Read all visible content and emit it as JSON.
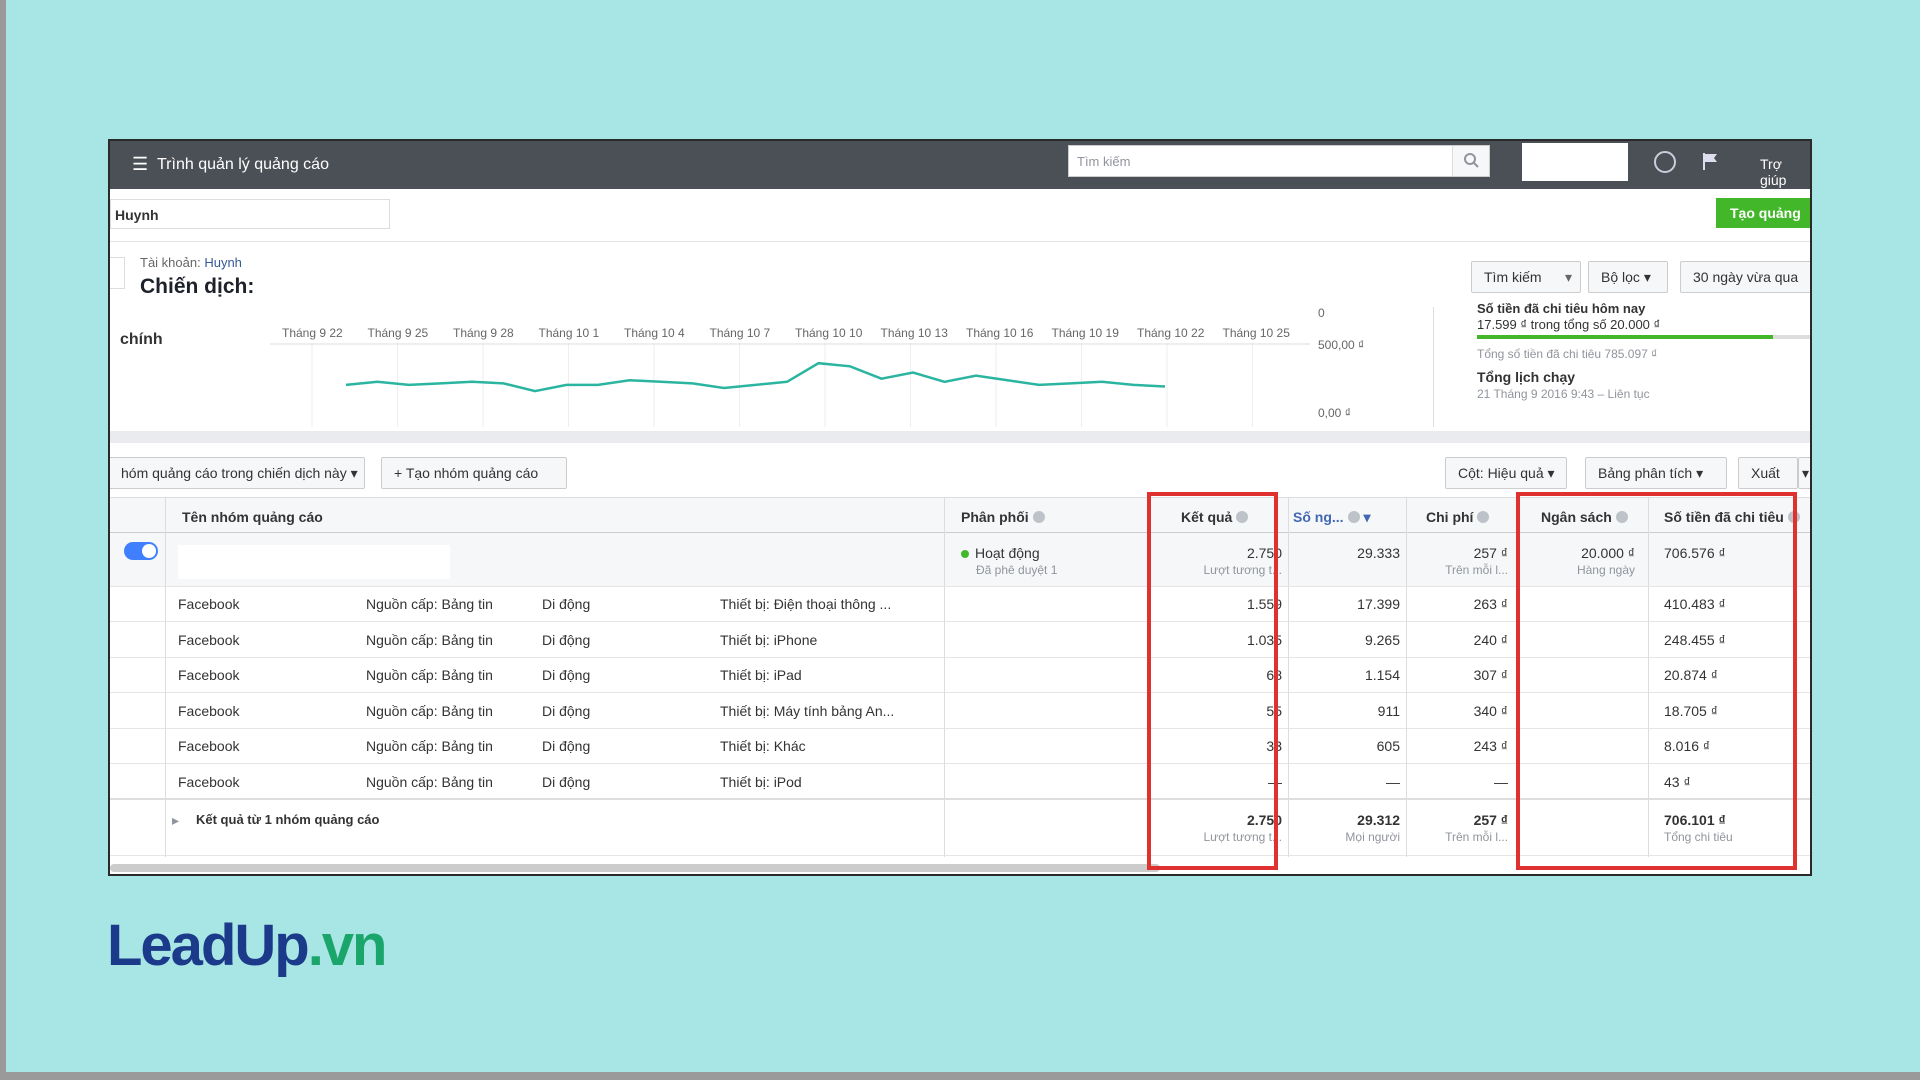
{
  "topbar": {
    "title": "Trình quản lý quảng cáo",
    "search_placeholder": "Tìm kiếm",
    "help": "Trợ giúp"
  },
  "account": {
    "selected": "Huynh",
    "create_button": "Tạo quảng"
  },
  "header": {
    "breadcrumb_label": "Tài khoản:",
    "breadcrumb_value": "Huynh",
    "title": "Chiến dịch:",
    "buttons": {
      "search": "Tìm kiếm",
      "filter": "Bộ lọc",
      "date_range": "30 ngày vừa qua"
    }
  },
  "chart_section": {
    "side_label": "chính"
  },
  "chart_data": {
    "type": "line",
    "x": [
      "Tháng 9 22",
      "Tháng 9 25",
      "Tháng 9 28",
      "Tháng 10 1",
      "Tháng 10 4",
      "Tháng 10 7",
      "Tháng 10 10",
      "Tháng 10 13",
      "Tháng 10 16",
      "Tháng 10 19",
      "Tháng 10 22",
      "Tháng 10 25"
    ],
    "ytick_labels": [
      "0",
      "500,00 ₫",
      "0,00 ₫"
    ],
    "values": [
      22,
      24,
      22,
      23,
      24,
      23,
      18,
      22,
      22,
      25,
      24,
      23,
      20,
      22,
      24,
      36,
      34,
      26,
      30,
      24,
      28,
      25,
      22,
      23,
      24,
      22,
      21
    ],
    "color": "#2bb5a0"
  },
  "summary": {
    "today_label": "Số tiền đã chi tiêu hôm nay",
    "today_value": "17.599 ₫ trong tổng số 20.000 ₫",
    "today_progress": 0.88,
    "total_spent": "Tổng số tiền đã chi tiêu 785.097 ₫",
    "schedule_label": "Tổng lịch chạy",
    "schedule_value": "21 Tháng 9 2016 9:43 – Liên tục"
  },
  "toolbar": {
    "left_dropdown": "hóm quảng cáo trong chiến dịch này",
    "create_group": "Tạo nhóm quảng cáo",
    "columns": "Cột: Hiệu quả",
    "breakdown": "Bảng phân tích",
    "export": "Xuất"
  },
  "table": {
    "headers": {
      "name": "Tên nhóm quảng cáo",
      "delivery": "Phân phối",
      "results": "Kết quả",
      "reach": "Số ng...",
      "cost": "Chi phí",
      "budget": "Ngân sách",
      "spent": "Số tiền đã chi tiêu"
    },
    "main_row": {
      "delivery": "Hoạt động",
      "delivery_sub": "Đã phê duyệt 1",
      "results": "2.750",
      "results_sub": "Lượt tương t...",
      "reach": "29.333",
      "cost": "257 ₫",
      "cost_sub": "Trên mỗi l...",
      "budget": "20.000 ₫",
      "budget_sub": "Hàng ngày",
      "spent": "706.576 ₫"
    },
    "rows": [
      {
        "platform": "Facebook",
        "placement": "Nguồn cấp: Bảng tin",
        "device": "Di động",
        "detail": "Thiết bị: Điện thoại thông ...",
        "results": "1.559",
        "reach": "17.399",
        "cost": "263 ₫",
        "spent": "410.483 ₫"
      },
      {
        "platform": "Facebook",
        "placement": "Nguồn cấp: Bảng tin",
        "device": "Di động",
        "detail": "Thiết bị: iPhone",
        "results": "1.035",
        "reach": "9.265",
        "cost": "240 ₫",
        "spent": "248.455 ₫"
      },
      {
        "platform": "Facebook",
        "placement": "Nguồn cấp: Bảng tin",
        "device": "Di động",
        "detail": "Thiết bị: iPad",
        "results": "68",
        "reach": "1.154",
        "cost": "307 ₫",
        "spent": "20.874 ₫"
      },
      {
        "platform": "Facebook",
        "placement": "Nguồn cấp: Bảng tin",
        "device": "Di động",
        "detail": "Thiết bị: Máy tính bảng An...",
        "results": "55",
        "reach": "911",
        "cost": "340 ₫",
        "spent": "18.705 ₫"
      },
      {
        "platform": "Facebook",
        "placement": "Nguồn cấp: Bảng tin",
        "device": "Di động",
        "detail": "Thiết bị: Khác",
        "results": "33",
        "reach": "605",
        "cost": "243 ₫",
        "spent": "8.016 ₫"
      },
      {
        "platform": "Facebook",
        "placement": "Nguồn cấp: Bảng tin",
        "device": "Di động",
        "detail": "Thiết bị: iPod",
        "results": "—",
        "reach": "—",
        "cost": "—",
        "spent": "43 ₫"
      }
    ],
    "total_row": {
      "label": "Kết quả từ 1 nhóm quảng cáo",
      "results": "2.750",
      "results_sub": "Lượt tương t...",
      "reach": "29.312",
      "reach_sub": "Mọi người",
      "cost": "257 ₫",
      "cost_sub": "Trên mỗi l...",
      "spent": "706.101 ₫",
      "spent_sub": "Tổng chi tiêu"
    }
  },
  "logo": {
    "main": "LeadUp",
    "suffix": ".vn"
  },
  "colors": {
    "topbar": "#4b4f56",
    "accent_green": "#42b72a",
    "highlight": "#e03131",
    "link": "#365899"
  }
}
